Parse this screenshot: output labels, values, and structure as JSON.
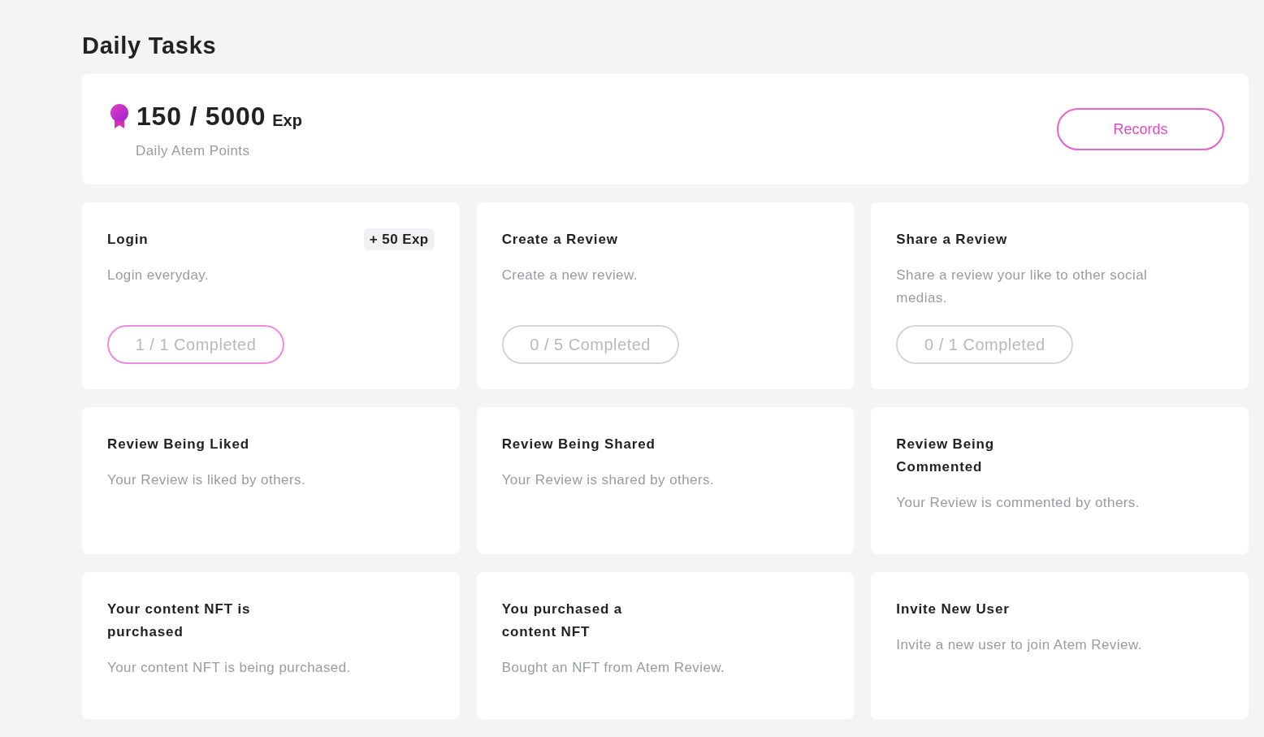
{
  "page_title": "Daily Tasks",
  "summary": {
    "points": "150 / 5000",
    "unit": "Exp",
    "label": "Daily Atem Points",
    "button": "Records"
  },
  "tasks": [
    {
      "title": "Login",
      "reward": "+ 50 Exp",
      "description": "Login everyday.",
      "progress": "1 / 1 Completed",
      "completed": true
    },
    {
      "title": "Create a Review",
      "description": "Create a new review.",
      "progress": "0 / 5 Completed",
      "completed": false
    },
    {
      "title": "Share a Review",
      "description": "Share a review your like to other social medias.",
      "progress": "0 / 1 Completed",
      "completed": false
    },
    {
      "title": "Review Being Liked",
      "description": "Your Review is liked by others."
    },
    {
      "title": "Review Being Shared",
      "description": "Your Review is shared by others."
    },
    {
      "title": "Review Being Commented",
      "description": "Your Review is commented by others."
    },
    {
      "title": "Your content NFT is purchased",
      "description": "Your content NFT is being purchased."
    },
    {
      "title": "You purchased a content NFT",
      "description": "Bought an NFT from Atem Review."
    },
    {
      "title": "Invite New User",
      "description": "Invite a new user to join Atem Review."
    }
  ]
}
